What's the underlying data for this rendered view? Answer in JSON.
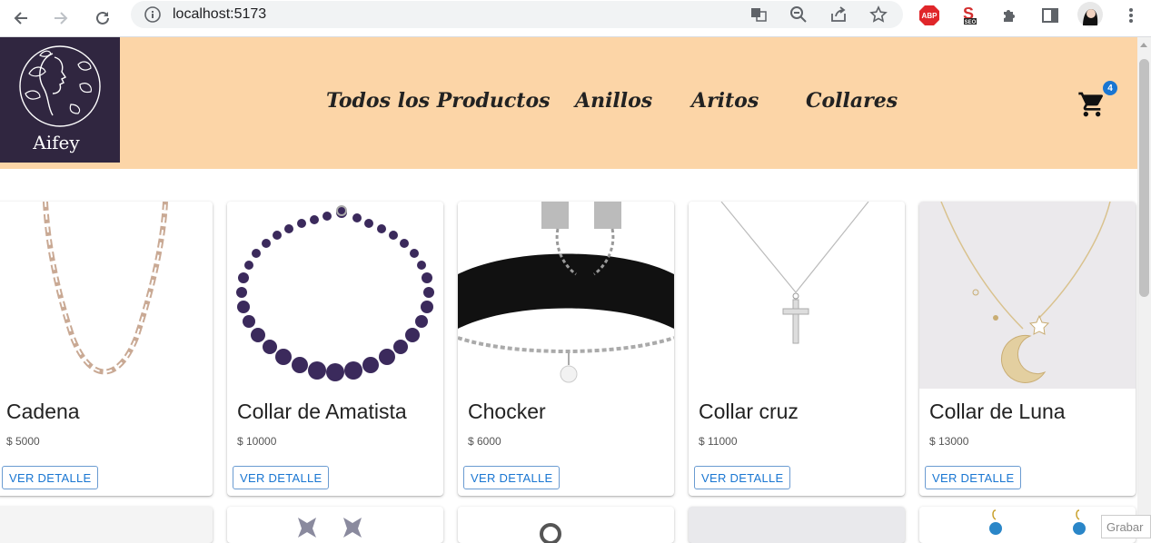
{
  "browser": {
    "url": "localhost:5173"
  },
  "brand": {
    "name": "Aifey"
  },
  "nav": {
    "items": [
      {
        "label": "Todos los Productos"
      },
      {
        "label": "Anillos"
      },
      {
        "label": "Aritos"
      },
      {
        "label": "Collares"
      }
    ]
  },
  "cart": {
    "count": "4"
  },
  "products": [
    {
      "name": "Cadena",
      "price": "$ 5000",
      "button": "VER DETALLE"
    },
    {
      "name": "Collar de Amatista",
      "price": "$ 10000",
      "button": "VER DETALLE"
    },
    {
      "name": "Chocker",
      "price": "$ 6000",
      "button": "VER DETALLE"
    },
    {
      "name": "Collar cruz",
      "price": "$ 11000",
      "button": "VER DETALLE"
    },
    {
      "name": "Collar de Luna",
      "price": "$ 13000",
      "button": "VER DETALLE"
    }
  ],
  "overlay": {
    "label": "Grabar"
  },
  "colors": {
    "header_bg": "#fcd5a7",
    "logo_bg": "#302640",
    "accent": "#1976d2"
  }
}
